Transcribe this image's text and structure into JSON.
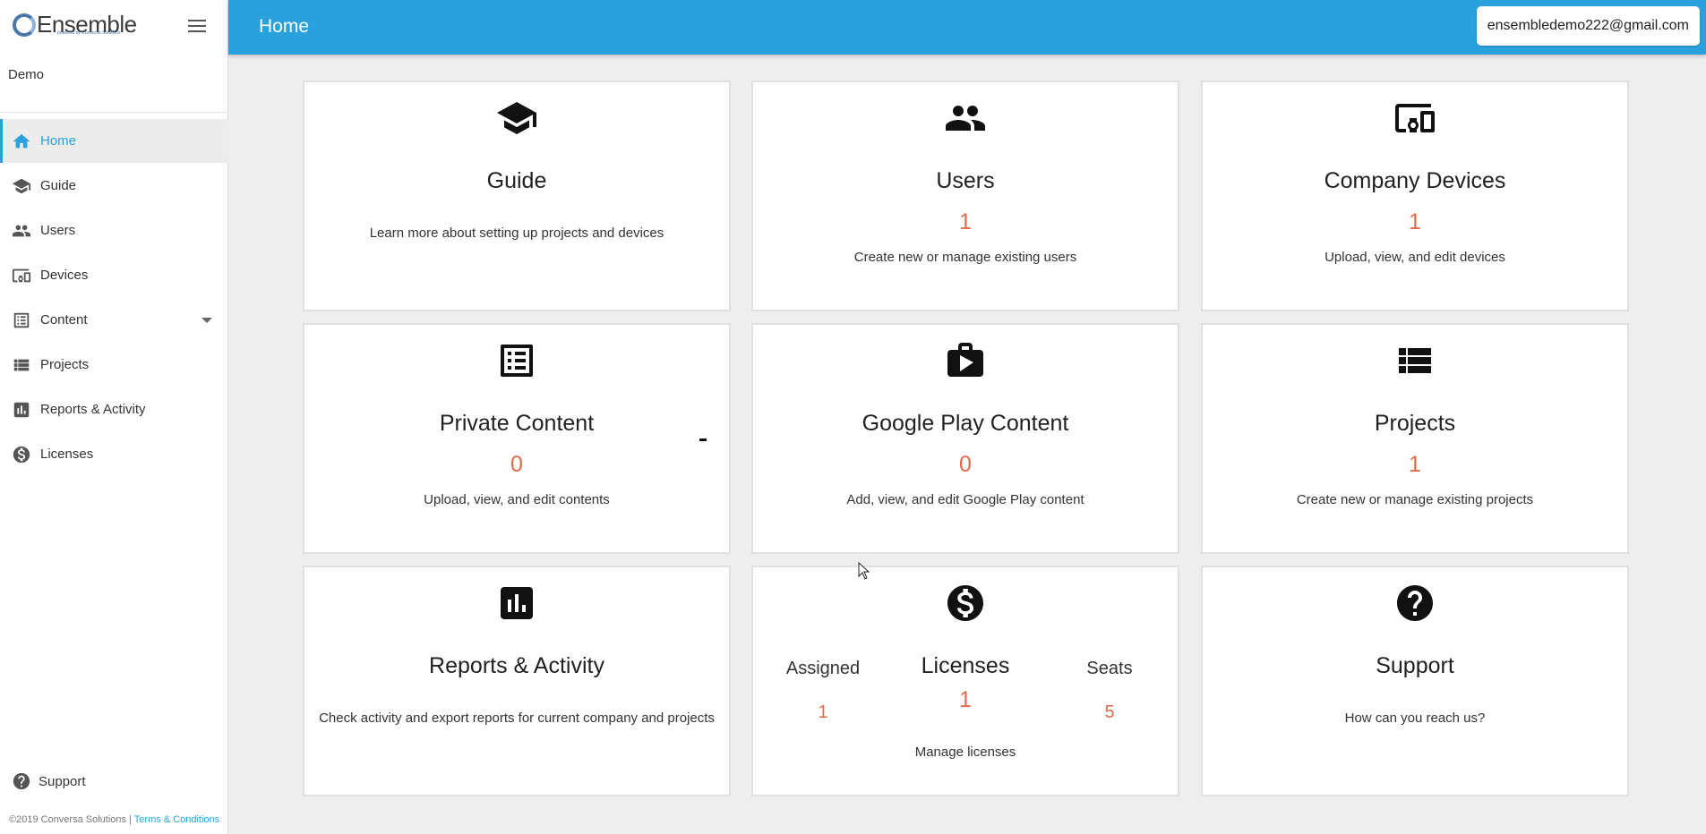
{
  "brand": {
    "name": "Ensemble",
    "tagline": "powered by Conversa Solutions"
  },
  "sidebar": {
    "company": "Demo",
    "items": [
      {
        "label": "Home",
        "icon": "home-icon",
        "active": true
      },
      {
        "label": "Guide",
        "icon": "graduation-cap-icon"
      },
      {
        "label": "Users",
        "icon": "users-icon"
      },
      {
        "label": "Devices",
        "icon": "devices-icon"
      },
      {
        "label": "Content",
        "icon": "list-icon",
        "expandable": true
      },
      {
        "label": "Projects",
        "icon": "projects-list-icon"
      },
      {
        "label": "Reports & Activity",
        "icon": "bar-chart-icon"
      },
      {
        "label": "Licenses",
        "icon": "dollar-icon"
      }
    ],
    "support": "Support",
    "footer": {
      "copyright": "©2019 Conversa Solutions | ",
      "terms": "Terms & Conditions"
    }
  },
  "header": {
    "title": "Home",
    "account": "ensembledemo222@gmail.com"
  },
  "cards": {
    "guide": {
      "title": "Guide",
      "desc": "Learn more about setting up projects and devices"
    },
    "users": {
      "title": "Users",
      "count": "1",
      "desc": "Create new or manage existing users"
    },
    "devices": {
      "title": "Company Devices",
      "count": "1",
      "desc": "Upload, view, and edit devices"
    },
    "private_content": {
      "title": "Private Content",
      "count": "0",
      "desc": "Upload, view, and edit contents"
    },
    "google_play": {
      "title": "Google Play Content",
      "count": "0",
      "desc": "Add, view, and edit Google Play content"
    },
    "projects": {
      "title": "Projects",
      "count": "1",
      "desc": "Create new or manage existing projects"
    },
    "reports": {
      "title": "Reports & Activity",
      "desc": "Check activity and export reports for current company and projects"
    },
    "licenses": {
      "title": "Licenses",
      "count": "1",
      "assigned_label": "Assigned",
      "assigned": "1",
      "seats_label": "Seats",
      "seats": "5",
      "desc": "Manage licenses"
    },
    "support": {
      "title": "Support",
      "desc": "How can you reach us?"
    }
  },
  "colors": {
    "accent": "#29a1dd",
    "count": "#e4684a",
    "background": "#eeeeee"
  }
}
